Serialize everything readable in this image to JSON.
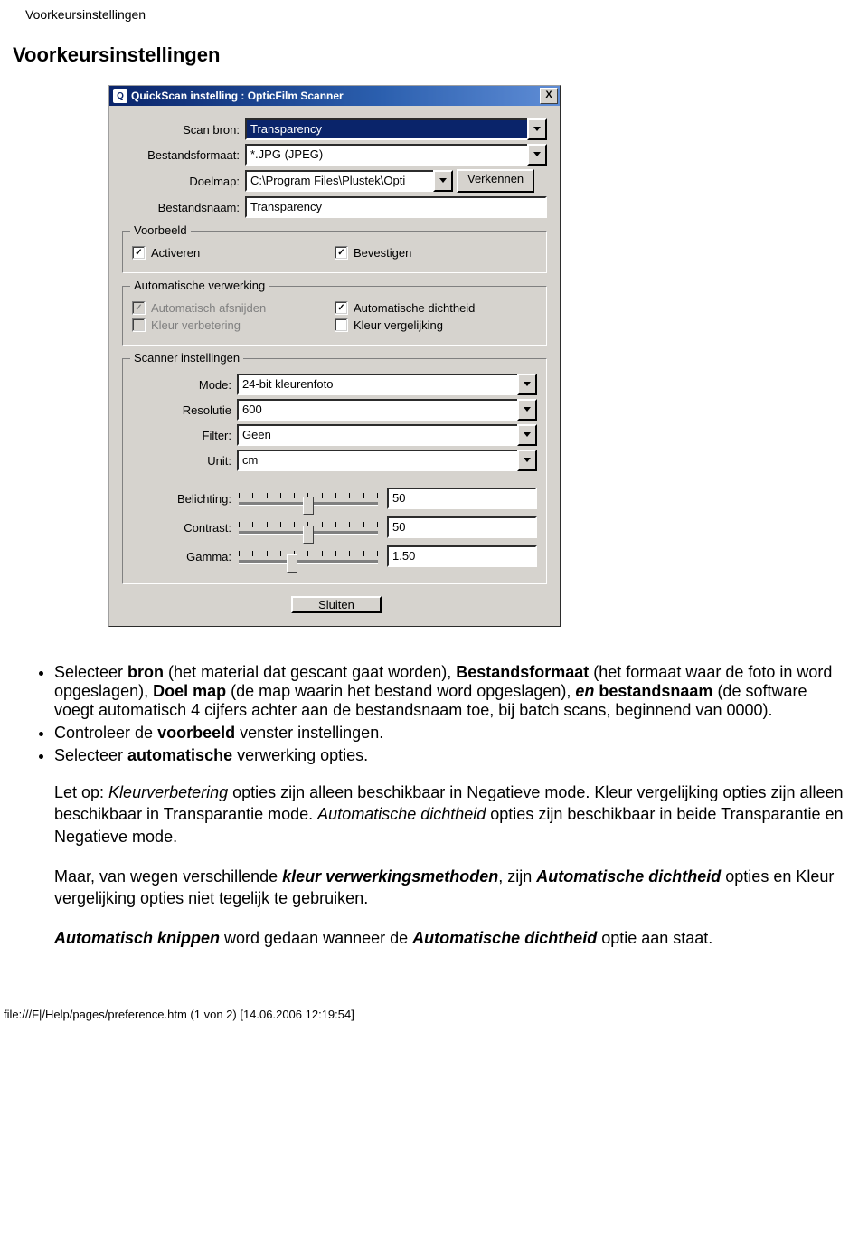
{
  "header_small": "Voorkeursinstellingen",
  "title": "Voorkeursinstellingen",
  "dialog": {
    "window_title": "QuickScan instelling : OpticFilm Scanner",
    "close_x": "X",
    "fields": {
      "scan_bron_label": "Scan bron:",
      "scan_bron_value": "Transparency",
      "bestandsformaat_label": "Bestandsformaat:",
      "bestandsformaat_value": "*.JPG (JPEG)",
      "doelmap_label": "Doelmap:",
      "doelmap_value": "C:\\Program Files\\Plustek\\Opti",
      "verkennen_label": "Verkennen",
      "bestandsnaam_label": "Bestandsnaam:",
      "bestandsnaam_value": "Transparency"
    },
    "voorbeeld": {
      "legend": "Voorbeeld",
      "activeren": "Activeren",
      "bevestigen": "Bevestigen"
    },
    "verwerking": {
      "legend": "Automatische verwerking",
      "afsnijden": "Automatisch afsnijden",
      "dichtheid": "Automatische dichtheid",
      "verbetering": "Kleur verbetering",
      "vergelijking": "Kleur vergelijking"
    },
    "scanner": {
      "legend": "Scanner instellingen",
      "mode_label": "Mode:",
      "mode_value": "24-bit kleurenfoto",
      "resolutie_label": "Resolutie",
      "resolutie_value": "600",
      "filter_label": "Filter:",
      "filter_value": "Geen",
      "unit_label": "Unit:",
      "unit_value": "cm",
      "belichting_label": "Belichting:",
      "belichting_val": "50",
      "contrast_label": "Contrast:",
      "contrast_val": "50",
      "gamma_label": "Gamma:",
      "gamma_val": "1.50"
    },
    "sluiten": "Sluiten"
  },
  "body": {
    "li1_a": "Selecteer ",
    "li1_bron": "bron",
    "li1_b": " (het material dat gescant gaat worden), ",
    "li1_bf": "Bestandsformaat",
    "li1_c": " (het formaat waar de foto in word opgeslagen), ",
    "li1_dm": "Doel map",
    "li1_d": " (de map waarin het bestand word opgeslagen), ",
    "li1_en": "en ",
    "li1_bn": "bestandsnaam",
    "li1_e": " (de software voegt automatisch 4 cijfers achter aan de bestandsnaam toe, bij batch scans, beginnend van 0000).",
    "li2_a": "Controleer de ",
    "li2_vb": "voorbeeld",
    "li2_b": " venster instellingen.",
    "li3_a": "Selecteer ",
    "li3_av": "automatische",
    "li3_b": " verwerking opties.",
    "p1_a": "Let op: ",
    "p1_kv": "Kleurverbetering",
    "p1_b": " opties zijn alleen beschikbaar in Negatieve mode. Kleur vergelijking opties zijn alleen beschikbaar in Transparantie mode. ",
    "p1_ad": "Automatische dichtheid",
    "p1_c": " opties zijn beschikbaar in beide Transparantie en Negatieve mode.",
    "p2_a": "Maar, van wegen verschillende ",
    "p2_kvm": "kleur verwerkingsmethoden",
    "p2_b": ", zijn ",
    "p2_ad": "Automatische dichtheid",
    "p2_c": " opties en Kleur vergelijking opties niet tegelijk te gebruiken.",
    "p3_ak": "Automatisch knippen",
    "p3_a": " word gedaan wanneer de ",
    "p3_ad": "Automatische dichtheid",
    "p3_b": " optie aan staat."
  },
  "footer": "file:///F|/Help/pages/preference.htm (1 von 2) [14.06.2006 12:19:54]"
}
